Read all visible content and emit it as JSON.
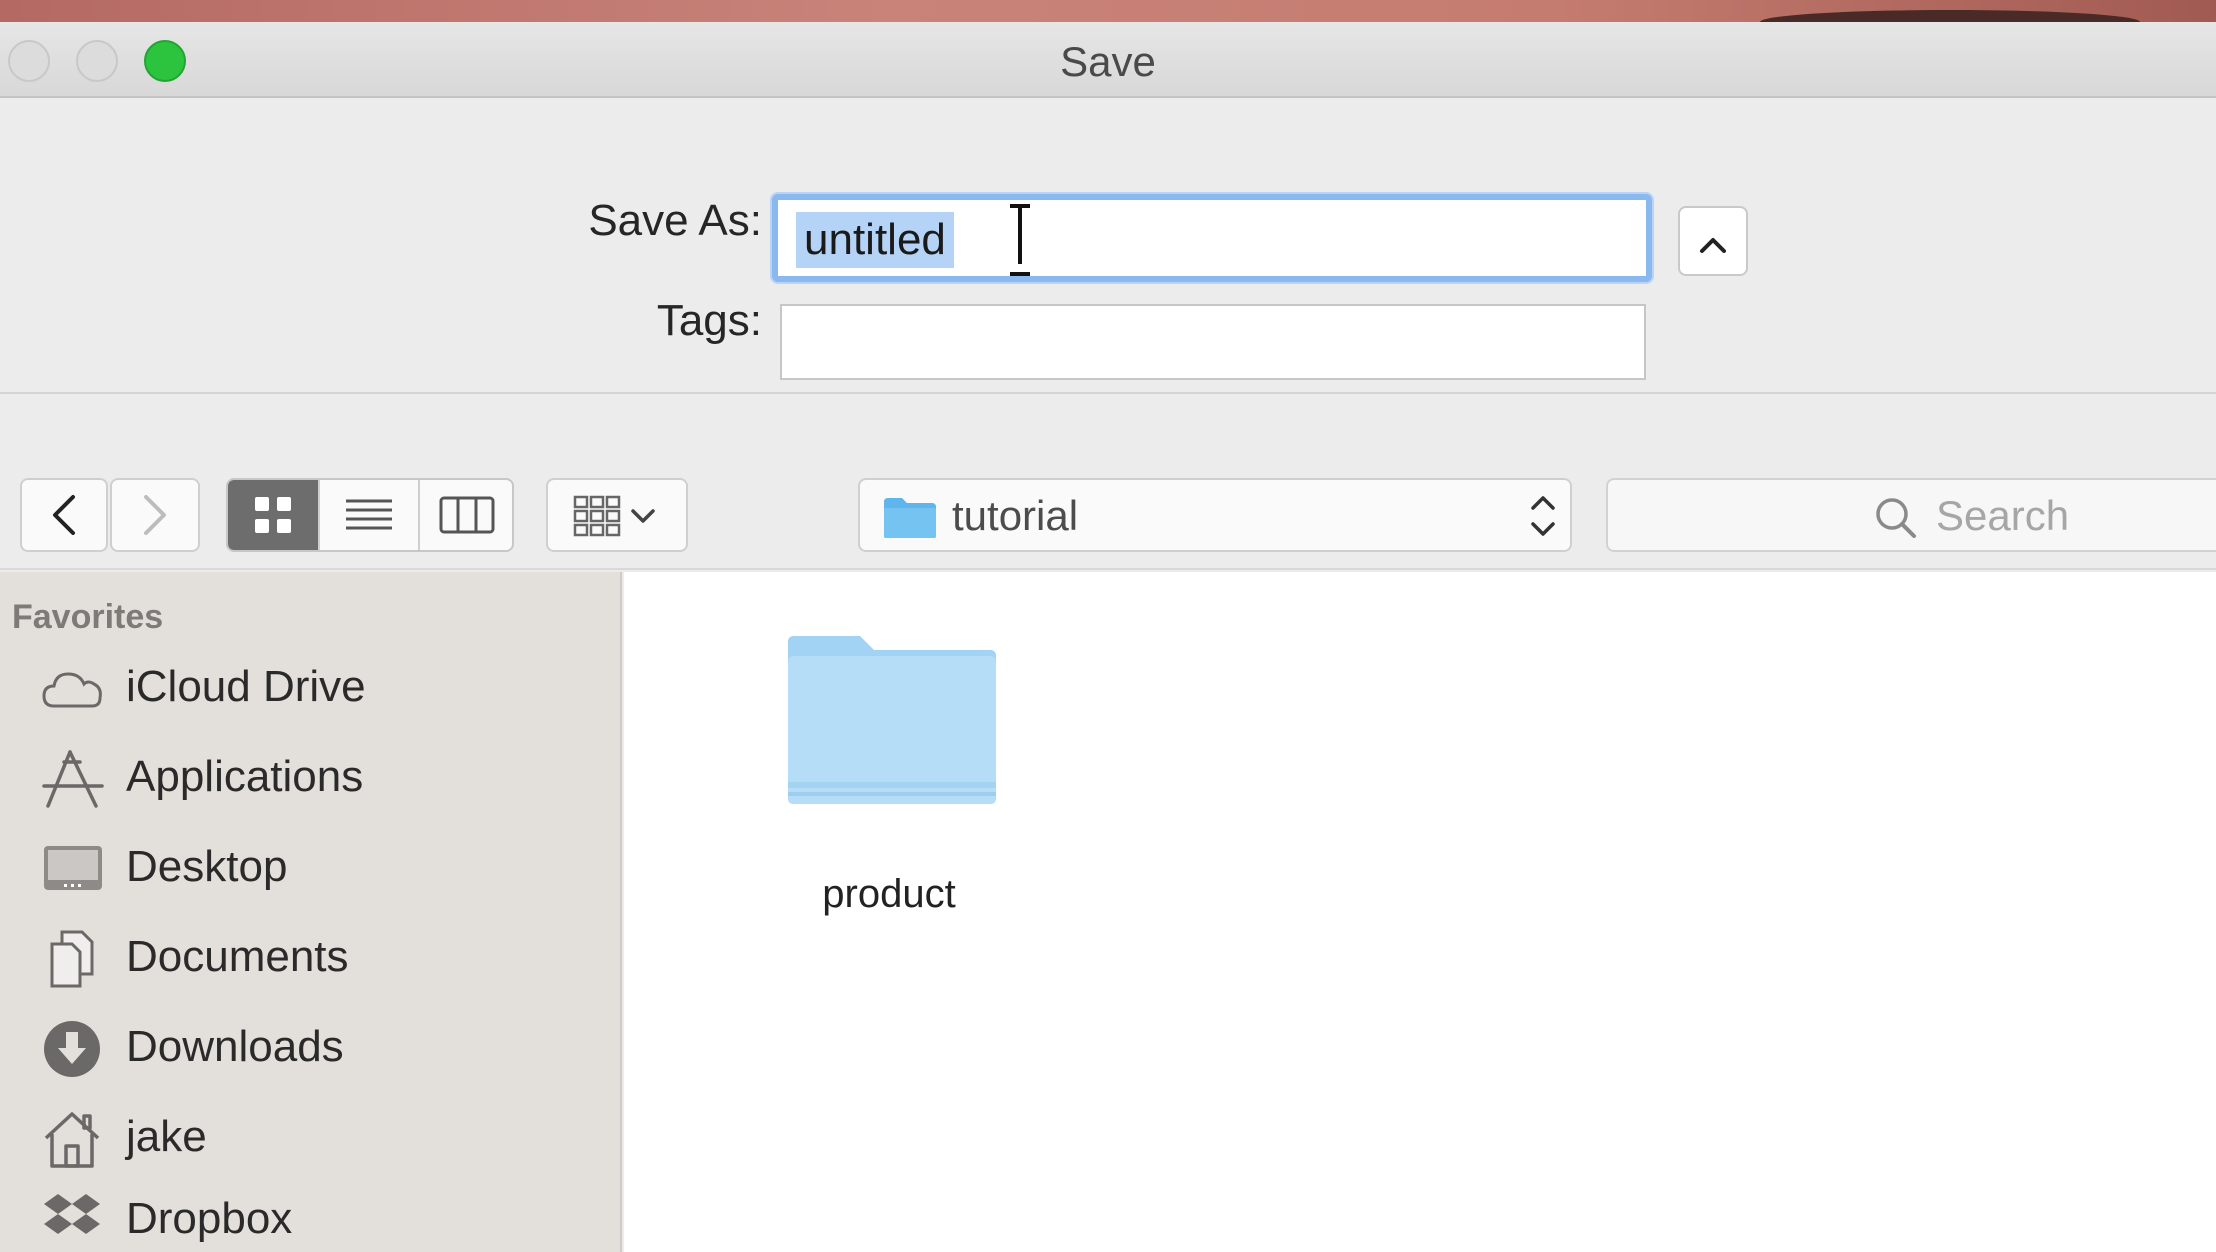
{
  "window": {
    "title": "Save"
  },
  "form": {
    "save_as_label": "Save As:",
    "save_as_value": "untitled",
    "tags_label": "Tags:",
    "tags_value": "",
    "disclosure_glyph": "^"
  },
  "toolbar": {
    "location": "tutorial",
    "search_placeholder": "Search",
    "active_view": "icon"
  },
  "sidebar": {
    "header": "Favorites",
    "items": [
      {
        "label": "iCloud Drive",
        "icon": "cloud-icon"
      },
      {
        "label": "Applications",
        "icon": "applications-icon"
      },
      {
        "label": "Desktop",
        "icon": "desktop-icon"
      },
      {
        "label": "Documents",
        "icon": "documents-icon"
      },
      {
        "label": "Downloads",
        "icon": "downloads-icon"
      },
      {
        "label": "jake",
        "icon": "home-icon"
      },
      {
        "label": "Dropbox",
        "icon": "dropbox-icon"
      }
    ]
  },
  "content": {
    "items": [
      {
        "name": "product",
        "type": "folder"
      }
    ]
  },
  "colors": {
    "accent": "#8ab9f0",
    "selection": "#b5d3f7",
    "zoom_button": "#2cc33e",
    "folder": "#a9d7f5"
  }
}
